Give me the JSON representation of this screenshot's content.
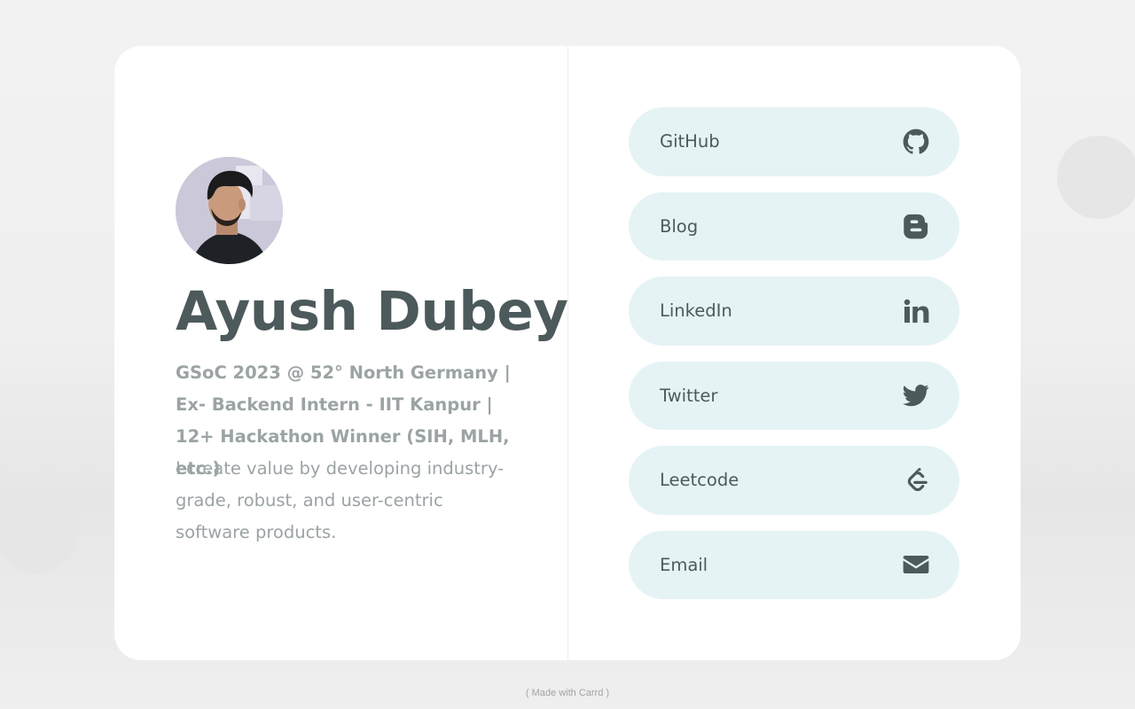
{
  "profile": {
    "name": "Ayush Dubey",
    "headline": "GSoC 2023 @ 52° North Germany | Ex- Backend Intern - IIT Kanpur | 12+ Hackathon Winner (SIH, MLH, etc.)",
    "bio": "I create value by developing industry-grade, robust, and user-centric software products."
  },
  "links": [
    {
      "label": "GitHub",
      "icon": "github-icon"
    },
    {
      "label": "Blog",
      "icon": "blogger-icon"
    },
    {
      "label": "LinkedIn",
      "icon": "linkedin-icon"
    },
    {
      "label": "Twitter",
      "icon": "twitter-icon"
    },
    {
      "label": "Leetcode",
      "icon": "leetcode-icon"
    },
    {
      "label": "Email",
      "icon": "envelope-icon"
    }
  ],
  "footer": {
    "text": "( Made with Carrd )"
  },
  "colors": {
    "text_dark": "#4d5a5c",
    "text_muted": "#9ba3a5",
    "button_bg": "#e5f3f5",
    "card_bg": "#ffffff",
    "page_bg": "#f0f0f0"
  }
}
